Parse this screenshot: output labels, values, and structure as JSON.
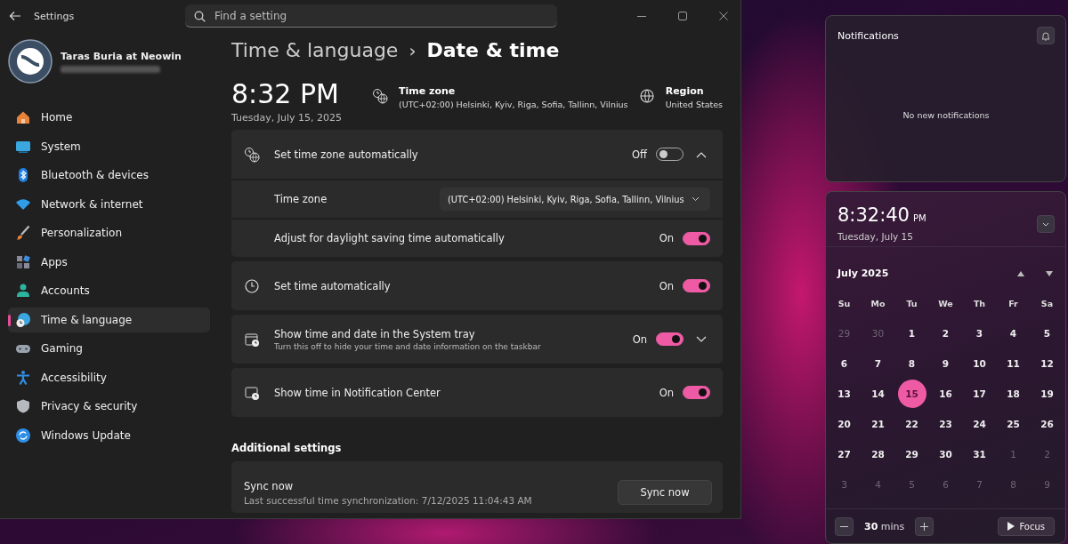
{
  "window": {
    "title": "Settings"
  },
  "search": {
    "placeholder": "Find a setting"
  },
  "user": {
    "name": "Taras Buria at Neowin"
  },
  "nav": [
    {
      "label": "Home",
      "selected": false
    },
    {
      "label": "System",
      "selected": false
    },
    {
      "label": "Bluetooth & devices",
      "selected": false
    },
    {
      "label": "Network & internet",
      "selected": false
    },
    {
      "label": "Personalization",
      "selected": false
    },
    {
      "label": "Apps",
      "selected": false
    },
    {
      "label": "Accounts",
      "selected": false
    },
    {
      "label": "Time & language",
      "selected": true
    },
    {
      "label": "Gaming",
      "selected": false
    },
    {
      "label": "Accessibility",
      "selected": false
    },
    {
      "label": "Privacy & security",
      "selected": false
    },
    {
      "label": "Windows Update",
      "selected": false
    }
  ],
  "breadcrumb": {
    "parent": "Time & language",
    "separator": "›",
    "current": "Date & time"
  },
  "clock": {
    "time": "8:32 PM",
    "date": "Tuesday, July 15, 2025"
  },
  "info": [
    {
      "label": "Time zone",
      "value": "(UTC+02:00) Helsinki, Kyiv, Riga, Sofia, Tallinn, Vilnius"
    },
    {
      "label": "Region",
      "value": "United States"
    }
  ],
  "cards": [
    {
      "rows": [
        {
          "kind": "toggle",
          "label": "Set time zone automatically",
          "state": "Off",
          "on": false,
          "expanded": true
        },
        {
          "kind": "dropdown",
          "label": "Time zone",
          "value": "(UTC+02:00) Helsinki, Kyiv, Riga, Sofia, Tallinn, Vilnius"
        },
        {
          "kind": "toggle",
          "label": "Adjust for daylight saving time automatically",
          "state": "On",
          "on": true
        }
      ]
    },
    {
      "rows": [
        {
          "kind": "toggle",
          "label": "Set time automatically",
          "state": "On",
          "on": true
        }
      ]
    },
    {
      "rows": [
        {
          "kind": "toggle",
          "label": "Show time and date in the System tray",
          "description": "Turn this off to hide your time and date information on the taskbar",
          "state": "On",
          "on": true,
          "expanded": false
        }
      ]
    },
    {
      "rows": [
        {
          "kind": "toggle",
          "label": "Show time in Notification Center",
          "state": "On",
          "on": true
        }
      ]
    }
  ],
  "additional": {
    "heading": "Additional settings",
    "title": "Sync now",
    "description": "Last successful time synchronization: 7/12/2025 11:04:43 AM",
    "button": "Sync now"
  },
  "notifications": {
    "title": "Notifications",
    "empty": "No new notifications"
  },
  "clock_panel": {
    "time": "8:32:40",
    "suffix": "PM",
    "date": "Tuesday, July 15"
  },
  "calendar": {
    "month": "July 2025",
    "weekdays": [
      "Su",
      "Mo",
      "Tu",
      "We",
      "Th",
      "Fr",
      "Sa"
    ],
    "days": [
      {
        "label": "29",
        "outside": true,
        "selected": false
      },
      {
        "label": "30",
        "outside": true,
        "selected": false
      },
      {
        "label": "1",
        "outside": false,
        "selected": false
      },
      {
        "label": "2",
        "outside": false,
        "selected": false
      },
      {
        "label": "3",
        "outside": false,
        "selected": false
      },
      {
        "label": "4",
        "outside": false,
        "selected": false
      },
      {
        "label": "5",
        "outside": false,
        "selected": false
      },
      {
        "label": "6",
        "outside": false,
        "selected": false
      },
      {
        "label": "7",
        "outside": false,
        "selected": false
      },
      {
        "label": "8",
        "outside": false,
        "selected": false
      },
      {
        "label": "9",
        "outside": false,
        "selected": false
      },
      {
        "label": "10",
        "outside": false,
        "selected": false
      },
      {
        "label": "11",
        "outside": false,
        "selected": false
      },
      {
        "label": "12",
        "outside": false,
        "selected": false
      },
      {
        "label": "13",
        "outside": false,
        "selected": false
      },
      {
        "label": "14",
        "outside": false,
        "selected": false
      },
      {
        "label": "15",
        "outside": false,
        "selected": true
      },
      {
        "label": "16",
        "outside": false,
        "selected": false
      },
      {
        "label": "17",
        "outside": false,
        "selected": false
      },
      {
        "label": "18",
        "outside": false,
        "selected": false
      },
      {
        "label": "19",
        "outside": false,
        "selected": false
      },
      {
        "label": "20",
        "outside": false,
        "selected": false
      },
      {
        "label": "21",
        "outside": false,
        "selected": false
      },
      {
        "label": "22",
        "outside": false,
        "selected": false
      },
      {
        "label": "23",
        "outside": false,
        "selected": false
      },
      {
        "label": "24",
        "outside": false,
        "selected": false
      },
      {
        "label": "25",
        "outside": false,
        "selected": false
      },
      {
        "label": "26",
        "outside": false,
        "selected": false
      },
      {
        "label": "27",
        "outside": false,
        "selected": false
      },
      {
        "label": "28",
        "outside": false,
        "selected": false
      },
      {
        "label": "29",
        "outside": false,
        "selected": false
      },
      {
        "label": "30",
        "outside": false,
        "selected": false
      },
      {
        "label": "31",
        "outside": false,
        "selected": false
      },
      {
        "label": "1",
        "outside": true,
        "selected": false
      },
      {
        "label": "2",
        "outside": true,
        "selected": false
      },
      {
        "label": "3",
        "outside": true,
        "selected": false
      },
      {
        "label": "4",
        "outside": true,
        "selected": false
      },
      {
        "label": "5",
        "outside": true,
        "selected": false
      },
      {
        "label": "6",
        "outside": true,
        "selected": false
      },
      {
        "label": "7",
        "outside": true,
        "selected": false
      },
      {
        "label": "8",
        "outside": true,
        "selected": false
      },
      {
        "label": "9",
        "outside": true,
        "selected": false
      }
    ]
  },
  "focus": {
    "duration": "**30** mins",
    "button": "Focus"
  }
}
